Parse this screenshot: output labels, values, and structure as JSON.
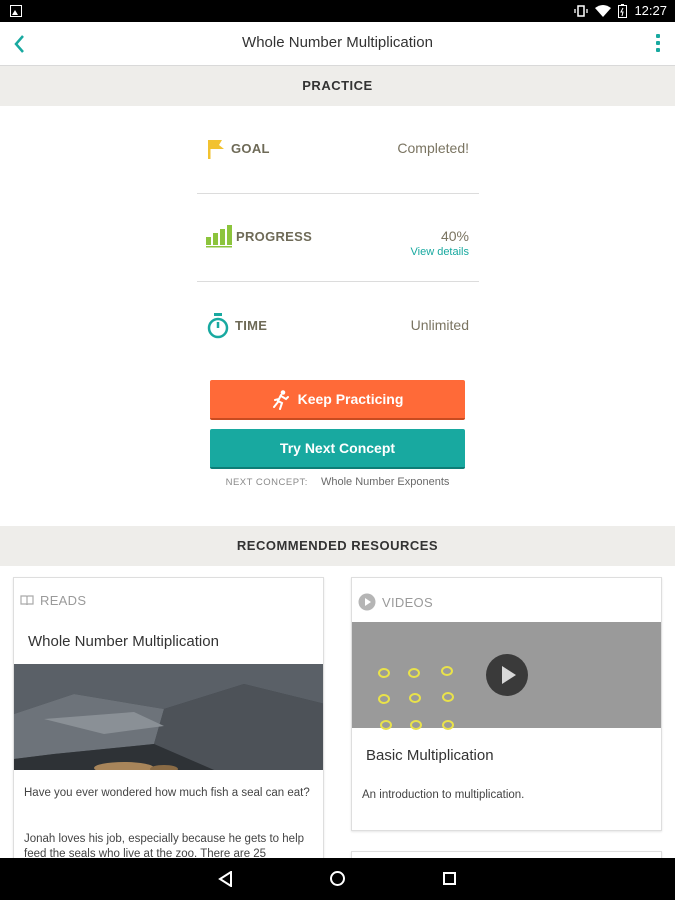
{
  "status_bar": {
    "time": "12:27"
  },
  "app_bar": {
    "title": "Whole Number Multiplication"
  },
  "practice": {
    "header": "PRACTICE",
    "goal": {
      "label": "GOAL",
      "value": "Completed!"
    },
    "progress": {
      "label": "PROGRESS",
      "value": "40%",
      "link": "View details"
    },
    "time": {
      "label": "TIME",
      "value": "Unlimited"
    },
    "keep_practicing": "Keep Practicing",
    "try_next": "Try Next Concept",
    "next_concept_label": "NEXT CONCEPT:",
    "next_concept_value": "Whole Number Exponents"
  },
  "resources": {
    "header": "RECOMMENDED RESOURCES",
    "reads": {
      "type": "READS",
      "title": "Whole Number Multiplication",
      "desc1": "Have you ever wondered how much fish a seal can eat?",
      "desc2": "Jonah loves his job, especially because he gets to help feed the seals who live at the zoo. There are 25"
    },
    "videos": {
      "type": "VIDEOS",
      "title": "Basic Multiplication",
      "desc": "An introduction to multiplication."
    }
  },
  "colors": {
    "teal": "#18a9a0",
    "orange": "#ff6a38",
    "goal_yellow": "#f2c230",
    "progress_green": "#8cc43c"
  }
}
